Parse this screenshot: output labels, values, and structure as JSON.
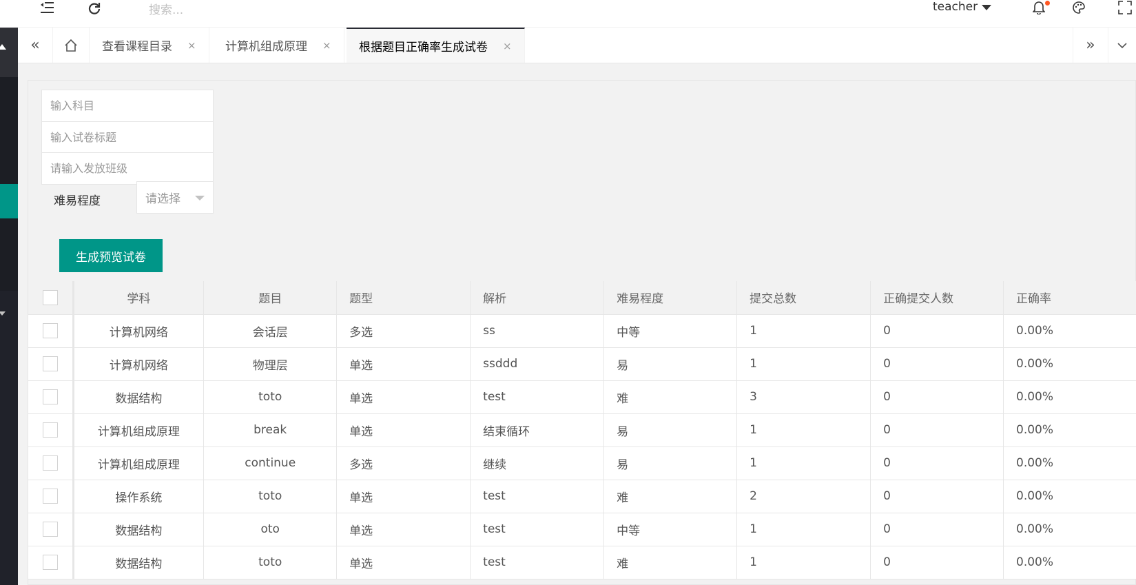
{
  "header": {
    "search_placeholder": "搜索...",
    "username": "teacher",
    "icons": [
      "menu-shrink-icon",
      "refresh-icon",
      "bell-icon",
      "palette-icon",
      "fullscreen-icon"
    ]
  },
  "tabs": [
    {
      "label": "查看课程目录",
      "active": false
    },
    {
      "label": "计算机组成原理",
      "active": false
    },
    {
      "label": "根据题目正确率生成试卷",
      "active": true
    }
  ],
  "tab_close_glyph": "×",
  "form": {
    "subject_placeholder": "输入科目",
    "title_placeholder": "输入试卷标题",
    "class_placeholder": "请输入发放班级",
    "difficulty_label": "难易程度",
    "difficulty_select_placeholder": "请选择",
    "generate_button": "生成预览试卷"
  },
  "table": {
    "headers": [
      "学科",
      "题目",
      "题型",
      "解析",
      "难易程度",
      "提交总数",
      "正确提交人数",
      "正确率"
    ],
    "rows": [
      [
        "计算机网络",
        "会话层",
        "多选",
        "ss",
        "中等",
        "1",
        "0",
        "0.00%"
      ],
      [
        "计算机网络",
        "物理层",
        "单选",
        "ssddd",
        "易",
        "1",
        "0",
        "0.00%"
      ],
      [
        "数据结构",
        "toto",
        "单选",
        "test",
        "难",
        "3",
        "0",
        "0.00%"
      ],
      [
        "计算机组成原理",
        "break",
        "单选",
        "结束循环",
        "易",
        "1",
        "0",
        "0.00%"
      ],
      [
        "计算机组成原理",
        "continue",
        "多选",
        "继续",
        "易",
        "1",
        "0",
        "0.00%"
      ],
      [
        "操作系统",
        "toto",
        "单选",
        "test",
        "难",
        "2",
        "0",
        "0.00%"
      ],
      [
        "数据结构",
        "oto",
        "单选",
        "test",
        "中等",
        "1",
        "0",
        "0.00%"
      ],
      [
        "数据结构",
        "toto",
        "单选",
        "test",
        "难",
        "1",
        "0",
        "0.00%"
      ]
    ]
  },
  "colors": {
    "primary": "#009688",
    "sidebar_dark": "#20222a",
    "notification_dot": "#ff5722"
  }
}
